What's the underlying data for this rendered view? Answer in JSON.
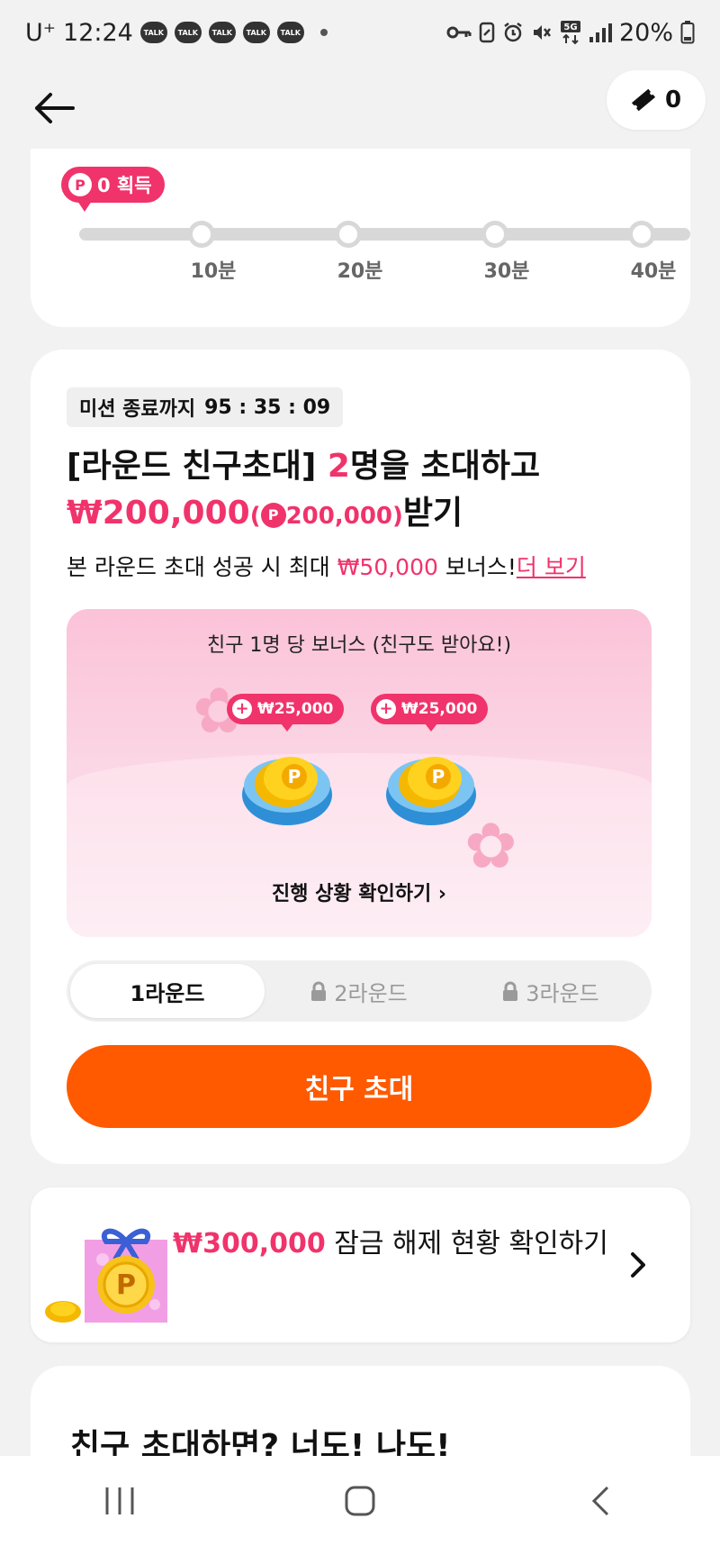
{
  "status_bar": {
    "carrier": "U⁺",
    "time": "12:24",
    "talk_badge": "TALK",
    "battery": "20%"
  },
  "header": {
    "ticket_count": "0"
  },
  "progress_card": {
    "point_tag": "0 획득",
    "point_icon": "P",
    "milestones": [
      "10분",
      "20분",
      "30분",
      "40분"
    ]
  },
  "mission_card": {
    "timer_label": "미션 종료까지",
    "timer_value": "95 : 35 : 09",
    "headline_prefix": "[라운드 친구초대] ",
    "headline_count": "2",
    "headline_suffix": "명을 초대하고",
    "reward_amount": "₩200,000",
    "reward_points_open": "(",
    "reward_points": "200,000)",
    "reward_suffix": "받기",
    "subline_prefix": "본 라운드 초대 성공 시 최대 ",
    "subline_bonus": "₩50,000",
    "subline_suffix": " 보너스!",
    "more_link": "더 보기",
    "bonus_box": {
      "title": "친구 1명 당 보너스 (친구도 받아요!)",
      "rewards": [
        "₩25,000",
        "₩25,000"
      ],
      "progress_link": "진행 상황 확인하기 ›"
    },
    "rounds": [
      {
        "label": "1라운드",
        "locked": false
      },
      {
        "label": "2라운드",
        "locked": true
      },
      {
        "label": "3라운드",
        "locked": true
      }
    ],
    "invite_button": "친구 초대"
  },
  "unlock_card": {
    "amount": "₩300,000",
    "text": " 잠금 해제 현황 확인하기"
  },
  "bottom_card": {
    "title": "친구 초대하면? 너도! 나도!"
  },
  "colors": {
    "accent_pink": "#f0336b",
    "accent_orange": "#ff5a00"
  }
}
